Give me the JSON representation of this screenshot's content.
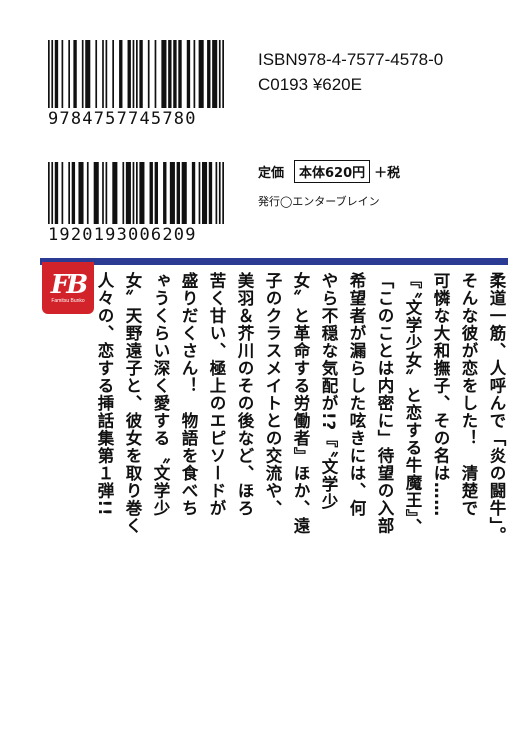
{
  "barcode_top": {
    "digits": "9784757745780",
    "isbn": "ISBN978-4-7577-4578-0",
    "classification": "C0193 ¥620E"
  },
  "barcode_bottom": {
    "digits": "1920193006209"
  },
  "price": {
    "label": "定価",
    "boxed": "本体620円",
    "tax": "＋税"
  },
  "publisher": "発行◯エンターブレイン",
  "logo": {
    "mark": "FB",
    "sub": "Famitsu Bunko",
    "color": "#d2232a"
  },
  "series_bar_color": "#2b3b94",
  "blurb_columns": [
    "柔道一筋、人呼んで「炎の闘牛」。",
    "そんな彼が恋をした！　清楚で",
    "可憐な大和撫子、その名は……",
    "『〝文学少女〟と恋する牛魔王』、",
    "「このことは内密に」待望の入部",
    "希望者が漏らした呟きには、何",
    "やら不穏な気配が!?『〝文学少",
    "女〟と革命する労働者』ほか、遠",
    "子のクラスメイトとの交流や、",
    "美羽＆芥川のその後など、ほろ",
    "苦く甘い、極上のエピソードが",
    "盛りだくさん！　物語を食べち",
    "ゃうくらい深く愛する〝文学少",
    "女〟天野遠子と、彼女を取り巻く",
    "人々の、恋する挿話集第１弾!!"
  ]
}
